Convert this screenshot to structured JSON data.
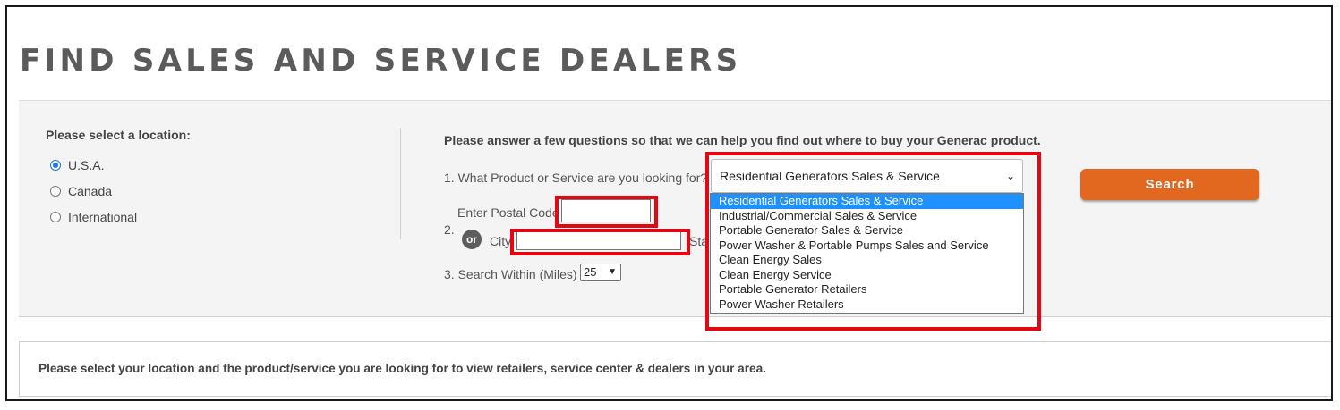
{
  "page_title": "FIND SALES AND SERVICE DEALERS",
  "location": {
    "label": "Please select a location:",
    "options": [
      {
        "label": "U.S.A.",
        "selected": true
      },
      {
        "label": "Canada",
        "selected": false
      },
      {
        "label": "International",
        "selected": false
      }
    ]
  },
  "form": {
    "intro": "Please answer a few questions so that we can help you find out where to buy your Generac product.",
    "q1_label": "1. What Product or Service are you looking for?",
    "product_selected": "Residential Generators Sales & Service",
    "product_options": [
      "Residential Generators Sales & Service",
      "Industrial/Commercial Sales & Service",
      "Portable Generator Sales & Service",
      "Power Washer & Portable Pumps Sales and Service",
      "Clean Energy Sales",
      "Clean Energy Service",
      "Portable Generator Retailers",
      "Power Washer Retailers"
    ],
    "q2_number": "2.",
    "postal_label": "Enter Postal Code",
    "postal_value": "",
    "or_label": "or",
    "city_label": "City",
    "city_value": "",
    "state_label_partial": "Sta",
    "q3_label": "3. Search Within (Miles)",
    "miles_value": "25"
  },
  "search_button": "Search",
  "footer_message": "Please select your location and the product/service you are looking for to view retailers, service center & dealers in your area.",
  "colors": {
    "accent_orange": "#e2681f",
    "highlight_red": "#e30613",
    "selected_blue": "#1e90ff"
  }
}
